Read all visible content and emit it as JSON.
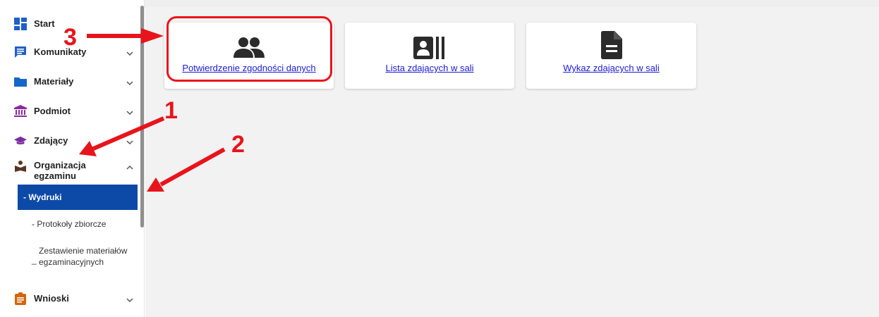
{
  "sidebar": {
    "items": [
      {
        "label": "Start",
        "icon": "dashboard-icon"
      },
      {
        "label": "Komunikaty",
        "icon": "message-icon"
      },
      {
        "label": "Materiały",
        "icon": "folder-icon"
      },
      {
        "label": "Podmiot",
        "icon": "institution-icon"
      },
      {
        "label": "Zdający",
        "icon": "graduation-cap-icon"
      },
      {
        "label": "Organizacja egzaminu",
        "icon": "organization-icon"
      },
      {
        "label": "Wnioski",
        "icon": "clipboard-icon"
      }
    ],
    "subitems": [
      {
        "label": "- Wydruki",
        "active": true
      },
      {
        "label": "- Protokoły zbiorcze",
        "active": false
      },
      {
        "label": "Zestawienie materiałów egzaminacyjnych",
        "active": false
      }
    ]
  },
  "tiles": [
    {
      "label": "Potwierdzenie zgodności danych",
      "icon": "people-icon"
    },
    {
      "label": "Lista zdających w sali",
      "icon": "contact-card-icon"
    },
    {
      "label": "Wykaz zdających w sali",
      "icon": "document-icon"
    }
  ],
  "annotations": {
    "step1": "1",
    "step2": "2",
    "step3": "3"
  },
  "colors": {
    "accent": "#0d4aa8",
    "link": "#1a1ad6",
    "annotation": "#e8141b",
    "start_icon": "#1f5fc9",
    "komunikaty_icon": "#1f5fc9",
    "materialy_icon": "#1566c8",
    "podmiot_icon": "#8a2a9e",
    "zdajacy_icon": "#7b2fa0",
    "organizacja_icon": "#5a3524",
    "wnioski_icon": "#d4660a"
  }
}
